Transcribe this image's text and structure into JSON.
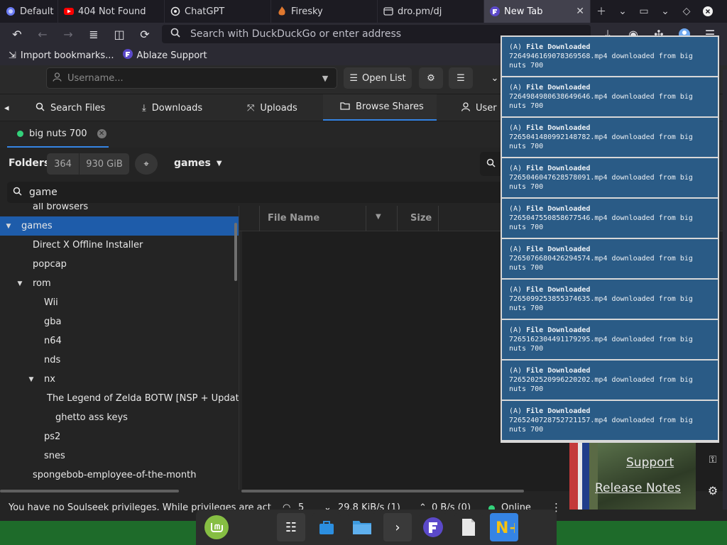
{
  "browser": {
    "tabs": [
      {
        "label": "Default",
        "icon": "firefox-icon",
        "active": false
      },
      {
        "label": "404 Not Found",
        "icon": "youtube-icon",
        "active": false
      },
      {
        "label": "ChatGPT",
        "icon": "openai-icon",
        "active": false
      },
      {
        "label": "Firesky",
        "icon": "flame-icon",
        "active": false
      },
      {
        "label": "dro.pm/dj",
        "icon": "page-icon",
        "active": false
      },
      {
        "label": "New Tab",
        "icon": "ablaze-icon",
        "active": true
      }
    ],
    "url_placeholder": "Search with DuckDuckGo or enter address",
    "bookmarks": [
      "Import bookmarks...",
      "Ablaze Support"
    ]
  },
  "app": {
    "username_placeholder": "Username...",
    "open_list_label": "Open List",
    "main_tabs": [
      {
        "label": "Search Files",
        "icon": "search-icon"
      },
      {
        "label": "Downloads",
        "icon": "download-icon"
      },
      {
        "label": "Uploads",
        "icon": "upload-icon"
      },
      {
        "label": "Browse Shares",
        "icon": "folder-icon"
      },
      {
        "label": "User",
        "icon": "user-icon"
      }
    ],
    "user_tab_label": "big nuts 700",
    "folders_label": "Folders",
    "folder_count": "364",
    "share_size": "930 GiB",
    "current_folder": "games",
    "filter_value": "game",
    "tree": [
      {
        "label": "all browsers",
        "level": 1,
        "expanded": null
      },
      {
        "label": "games",
        "level": 0,
        "expanded": true,
        "selected": true
      },
      {
        "label": "Direct X Offline Installer",
        "level": 1,
        "expanded": null
      },
      {
        "label": "popcap",
        "level": 1,
        "expanded": null
      },
      {
        "label": "rom",
        "level": 1,
        "expanded": true
      },
      {
        "label": "Wii",
        "level": 2,
        "expanded": null
      },
      {
        "label": "gba",
        "level": 2,
        "expanded": null
      },
      {
        "label": "n64",
        "level": 2,
        "expanded": null
      },
      {
        "label": "nds",
        "level": 2,
        "expanded": null
      },
      {
        "label": "nx",
        "level": 2,
        "expanded": true
      },
      {
        "label": "The Legend of Zelda BOTW [NSP + Update",
        "level": 3,
        "expanded": null
      },
      {
        "label": "ghetto ass keys",
        "level": 3,
        "expanded": null
      },
      {
        "label": "ps2",
        "level": 2,
        "expanded": null
      },
      {
        "label": "snes",
        "level": 2,
        "expanded": null
      },
      {
        "label": "spongebob-employee-of-the-month",
        "level": 1,
        "expanded": null
      }
    ],
    "file_columns": [
      "File Name",
      "Size"
    ],
    "status_message": "You have no Soulseek privileges. While privileges are act",
    "status_connections": "5",
    "status_download": "29.8 KiB/s (1)",
    "status_upload": "0 B/s (0)",
    "status_online": "Online"
  },
  "notifications": [
    {
      "tag": "(A)",
      "title": "File Downloaded",
      "line1": "7264946169078369568.mp4 downloaded from big",
      "line2": "nuts 700"
    },
    {
      "tag": "(A)",
      "title": "File Downloaded",
      "line1": "7264984980638649646.mp4 downloaded from big",
      "line2": "nuts 700"
    },
    {
      "tag": "(A)",
      "title": "File Downloaded",
      "line1": "7265041480992148782.mp4 downloaded from big",
      "line2": "nuts 700"
    },
    {
      "tag": "(A)",
      "title": "File Downloaded",
      "line1": "7265046047628578091.mp4 downloaded from big",
      "line2": "nuts 700"
    },
    {
      "tag": "(A)",
      "title": "File Downloaded",
      "line1": "7265047550858677546.mp4 downloaded from big",
      "line2": "nuts 700"
    },
    {
      "tag": "(A)",
      "title": "File Downloaded",
      "line1": "7265076680426294574.mp4 downloaded from big",
      "line2": "nuts 700"
    },
    {
      "tag": "(A)",
      "title": "File Downloaded",
      "line1": "7265099253855374635.mp4 downloaded from big",
      "line2": "nuts 700"
    },
    {
      "tag": "(A)",
      "title": "File Downloaded",
      "line1": "7265162304491179295.mp4 downloaded from big",
      "line2": "nuts 700"
    },
    {
      "tag": "(A)",
      "title": "File Downloaded",
      "line1": "7265202520996220202.mp4 downloaded from big",
      "line2": "nuts 700"
    },
    {
      "tag": "(A)",
      "title": "File Downloaded",
      "line1": "7265240728752721157.mp4 downloaded from big",
      "line2": "nuts 700"
    }
  ],
  "newtab": {
    "support_label": "Support",
    "release_notes_label": "Release Notes"
  }
}
